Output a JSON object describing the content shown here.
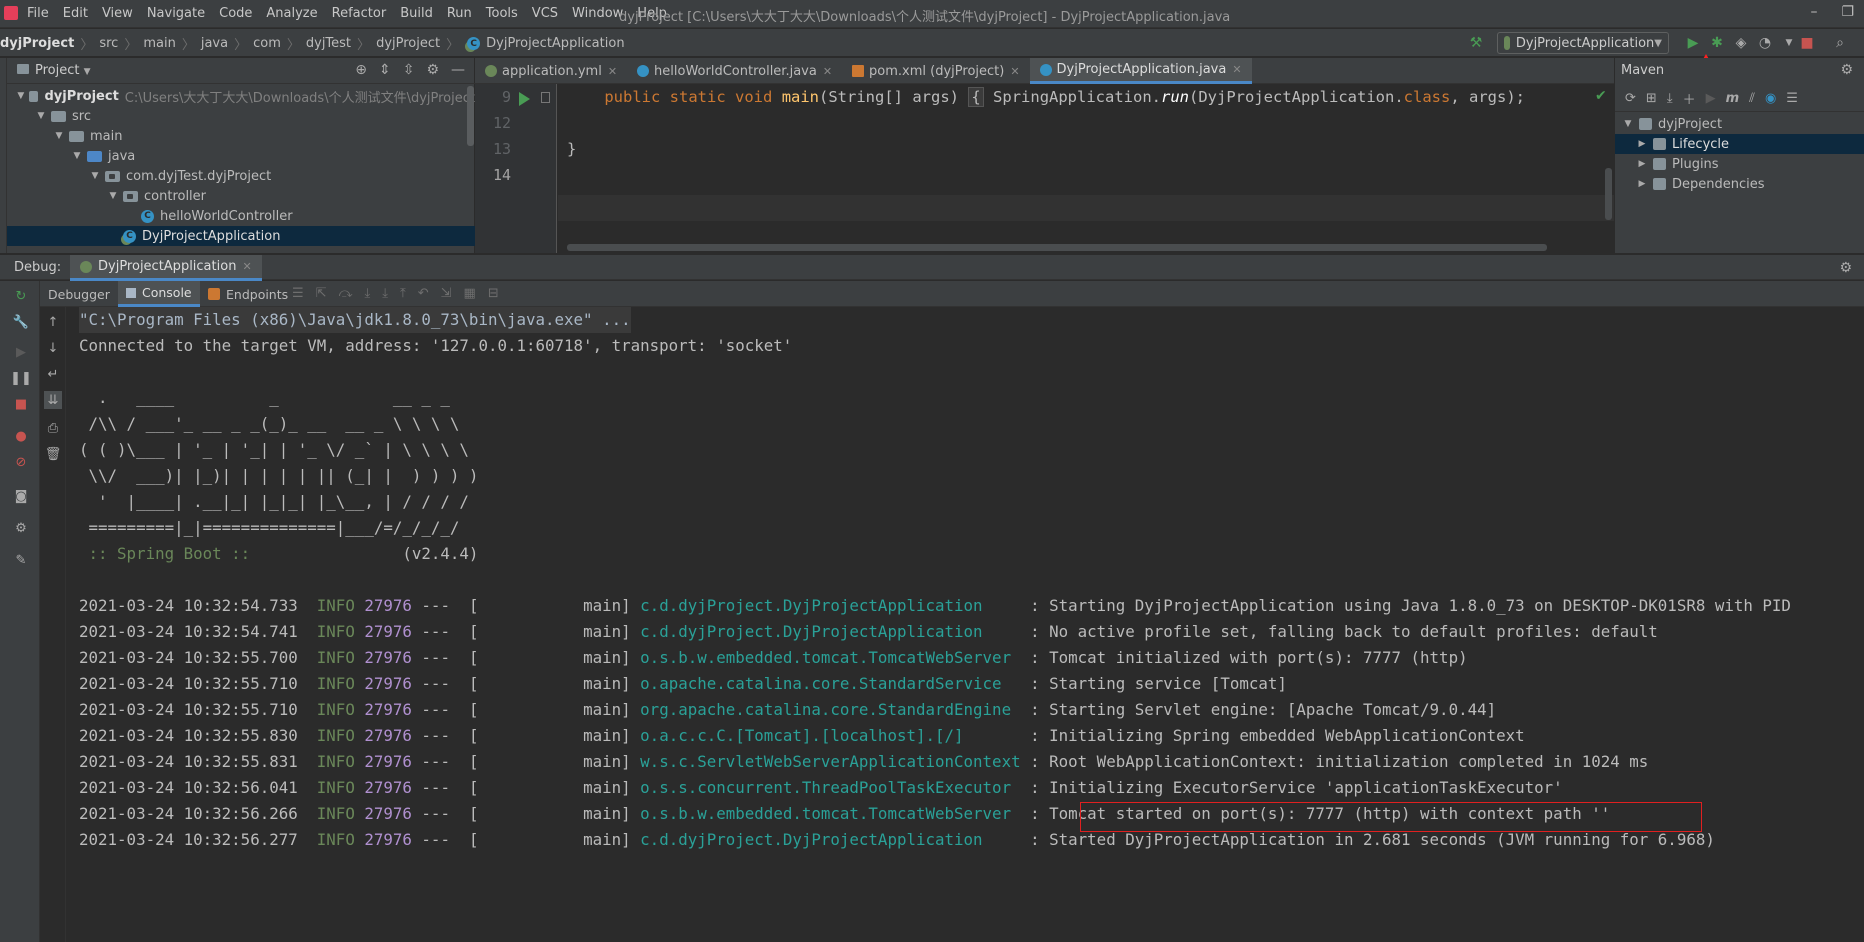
{
  "menubar": {
    "items": [
      "File",
      "Edit",
      "View",
      "Navigate",
      "Code",
      "Analyze",
      "Refactor",
      "Build",
      "Run",
      "Tools",
      "VCS",
      "Window",
      "Help"
    ],
    "window_title": "dyjProject [C:\\Users\\大大丁大大\\Downloads\\个人测试文件\\dyjProject] - DyjProjectApplication.java",
    "restore_glyph": "❐",
    "min_glyph": "–"
  },
  "navbar": {
    "breadcrumbs": [
      "dyjProject",
      "src",
      "main",
      "java",
      "com",
      "dyjTest",
      "dyjProject",
      "DyjProjectApplication"
    ],
    "run_config": "DyjProjectApplication"
  },
  "project": {
    "title": "Project",
    "tree": [
      {
        "label": "dyjProject",
        "hint": "C:\\Users\\大大丁大大\\Downloads\\个人测试文件\\dyjProject",
        "depth": 0,
        "expanded": true,
        "type": "module"
      },
      {
        "label": "src",
        "depth": 1,
        "expanded": true,
        "type": "folder"
      },
      {
        "label": "main",
        "depth": 2,
        "expanded": true,
        "type": "folder"
      },
      {
        "label": "java",
        "depth": 3,
        "expanded": true,
        "type": "folder-blue"
      },
      {
        "label": "com.dyjTest.dyjProject",
        "depth": 4,
        "expanded": true,
        "type": "package"
      },
      {
        "label": "controller",
        "depth": 5,
        "expanded": true,
        "type": "package"
      },
      {
        "label": "helloWorldController",
        "depth": 6,
        "type": "class"
      },
      {
        "label": "DyjProjectApplication",
        "depth": 5,
        "type": "spring-class",
        "selected": true
      }
    ]
  },
  "editor": {
    "tabs": [
      {
        "label": "application.yml",
        "color": "#6a8759",
        "active": false
      },
      {
        "label": "helloWorldController.java",
        "color": "#3592c4",
        "active": false
      },
      {
        "label": "pom.xml (dyjProject)",
        "color": "#cc7832",
        "active": false
      },
      {
        "label": "DyjProjectApplication.java",
        "color": "#3592c4",
        "active": true
      }
    ],
    "line_numbers": [
      "9",
      "12",
      "13",
      "14"
    ],
    "code": {
      "indent": "    ",
      "kw_public": "public",
      "kw_static": "static",
      "kw_void": "void",
      "method": "main",
      "params": "(String[] args)",
      "fold_open": "{",
      "call_prefix": "SpringApplication.",
      "call_method": "run",
      "call_args_a": "(DyjProjectApplication.",
      "kw_class": "class",
      "call_args_b": ", args);",
      "close_brace": "}"
    }
  },
  "maven": {
    "title": "Maven",
    "tree": [
      {
        "label": "dyjProject",
        "depth": 0,
        "expanded": true
      },
      {
        "label": "Lifecycle",
        "depth": 1,
        "selected": true
      },
      {
        "label": "Plugins",
        "depth": 1
      },
      {
        "label": "Dependencies",
        "depth": 1
      }
    ]
  },
  "debug": {
    "label": "Debug:",
    "session_tab": "DyjProjectApplication",
    "subtabs": {
      "debugger": "Debugger",
      "console": "Console",
      "endpoints": "Endpoints"
    }
  },
  "console": {
    "cmd": "\"C:\\Program Files (x86)\\Java\\jdk1.8.0_73\\bin\\java.exe\" ...",
    "connected": "Connected to the target VM, address: '127.0.0.1:60718', transport: 'socket'",
    "banner": [
      "  .   ____          _            __ _ _",
      " /\\\\ / ___'_ __ _ _(_)_ __  __ _ \\ \\ \\ \\",
      "( ( )\\___ | '_ | '_| | '_ \\/ _` | \\ \\ \\ \\",
      " \\\\/  ___)| |_)| | | | | || (_| |  ) ) ) )",
      "  '  |____| .__|_| |_|_| |_\\__, | / / / /",
      " =========|_|==============|___/=/_/_/_/"
    ],
    "boot_label": " :: Spring Boot :: ",
    "boot_version": "               (v2.4.4)",
    "logs": [
      {
        "ts": "2021-03-24 10:32:54.733",
        "level": "INFO",
        "pid": "27976",
        "thread": "---  [           main] ",
        "logger": "c.d.dyjProject.DyjProjectApplication    ",
        "msg": " : Starting DyjProjectApplication using Java 1.8.0_73 on DESKTOP-DK01SR8 with PID"
      },
      {
        "ts": "2021-03-24 10:32:54.741",
        "level": "INFO",
        "pid": "27976",
        "thread": "---  [           main] ",
        "logger": "c.d.dyjProject.DyjProjectApplication    ",
        "msg": " : No active profile set, falling back to default profiles: default"
      },
      {
        "ts": "2021-03-24 10:32:55.700",
        "level": "INFO",
        "pid": "27976",
        "thread": "---  [           main] ",
        "logger": "o.s.b.w.embedded.tomcat.TomcatWebServer ",
        "msg": " : Tomcat initialized with port(s): 7777 (http)"
      },
      {
        "ts": "2021-03-24 10:32:55.710",
        "level": "INFO",
        "pid": "27976",
        "thread": "---  [           main] ",
        "logger": "o.apache.catalina.core.StandardService  ",
        "msg": " : Starting service [Tomcat]"
      },
      {
        "ts": "2021-03-24 10:32:55.710",
        "level": "INFO",
        "pid": "27976",
        "thread": "---  [           main] ",
        "logger": "org.apache.catalina.core.StandardEngine ",
        "msg": " : Starting Servlet engine: [Apache Tomcat/9.0.44]"
      },
      {
        "ts": "2021-03-24 10:32:55.830",
        "level": "INFO",
        "pid": "27976",
        "thread": "---  [           main] ",
        "logger": "o.a.c.c.C.[Tomcat].[localhost].[/]      ",
        "msg": " : Initializing Spring embedded WebApplicationContext"
      },
      {
        "ts": "2021-03-24 10:32:55.831",
        "level": "INFO",
        "pid": "27976",
        "thread": "---  [           main] ",
        "logger": "w.s.c.ServletWebServerApplicationContext",
        "msg": " : Root WebApplicationContext: initialization completed in 1024 ms"
      },
      {
        "ts": "2021-03-24 10:32:56.041",
        "level": "INFO",
        "pid": "27976",
        "thread": "---  [           main] ",
        "logger": "o.s.s.concurrent.ThreadPoolTaskExecutor ",
        "msg": " : Initializing ExecutorService 'applicationTaskExecutor'"
      },
      {
        "ts": "2021-03-24 10:32:56.266",
        "level": "INFO",
        "pid": "27976",
        "thread": "---  [           main] ",
        "logger": "o.s.b.w.embedded.tomcat.TomcatWebServer ",
        "msg": " : Tomcat started on port(s): 7777 (http) with context path ''"
      },
      {
        "ts": "2021-03-24 10:32:56.277",
        "level": "INFO",
        "pid": "27976",
        "thread": "---  [           main] ",
        "logger": "c.d.dyjProject.DyjProjectApplication    ",
        "msg": " : Started DyjProjectApplication in 2.681 seconds (JVM running for 6.968)"
      }
    ]
  },
  "colors": {
    "background": "#2b2b2b",
    "panel": "#3c3f41",
    "selection": "#0d293e",
    "accent": "#4a88c7",
    "log_level": "#6a8759",
    "log_pid": "#b090d0",
    "log_logger": "#2aa198",
    "highlight_box": "#e02020"
  }
}
